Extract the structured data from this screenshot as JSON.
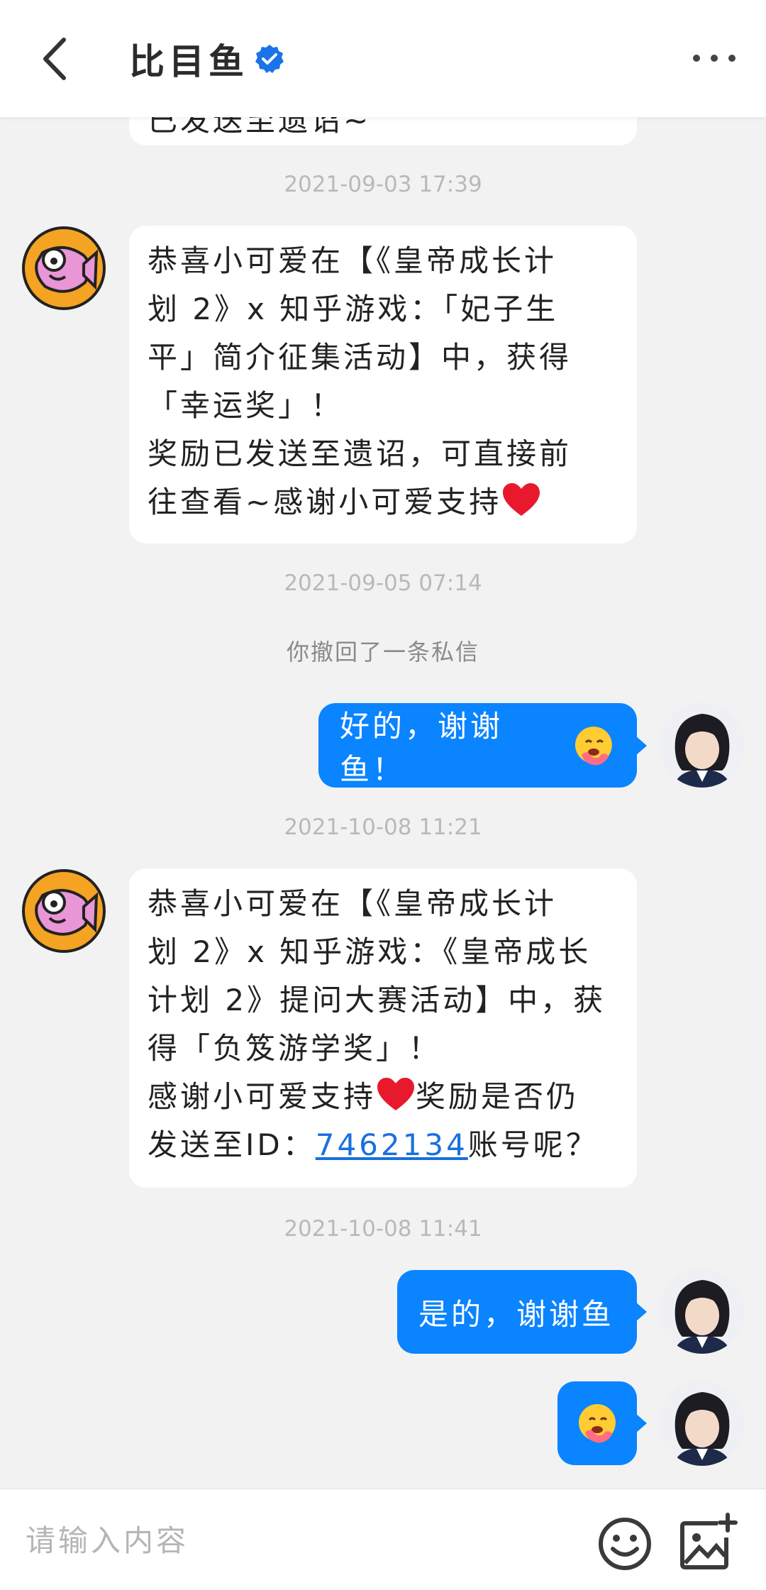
{
  "header": {
    "title": "比目鱼",
    "icons": {
      "back": "chevron-left-icon",
      "verified": "verified-check-icon",
      "more": "more-dots-icon"
    }
  },
  "colors": {
    "accent": "#0a84ff",
    "bubble_in": "#ffffff",
    "background": "#f2f2f2",
    "link": "#1a6fdf"
  },
  "chat": {
    "partial_top_text": "已发送至遗诏~",
    "msg1": {
      "timestamp": "2021-09-03 17:39",
      "lines": [
        "恭喜小可爱在【《皇帝成长计",
        "划 2》x 知乎游戏：「妃子生",
        "平」简介征集活动】中，获得",
        "「幸运奖」！",
        "奖励已发送至遗诏，可直接前",
        "往查看~感谢小可爱支持"
      ]
    },
    "recall": {
      "timestamp": "2021-09-05 07:14",
      "text": "你撤回了一条私信"
    },
    "reply1": {
      "text": "好的，谢谢鱼！",
      "emoji": "hugging-face-emoji"
    },
    "msg2": {
      "timestamp": "2021-10-08 11:21",
      "lines": [
        "恭喜小可爱在【《皇帝成长计",
        "划 2》x 知乎游戏：《皇帝成长",
        "计划 2》提问大赛活动】中，获",
        "得「负笈游学奖」！"
      ],
      "line5_a": "感谢小可爱支持",
      "line5_b": "奖励是否仍",
      "line6_prefix": "发送至ID：",
      "id_link": "7462134",
      "line6_suffix": "账号呢？"
    },
    "reply2": {
      "timestamp": "2021-10-08 11:41",
      "text": "是的，谢谢鱼"
    },
    "reply3": {
      "emoji": "hugging-face-emoji"
    }
  },
  "input": {
    "placeholder": "请输入内容",
    "value": ""
  }
}
